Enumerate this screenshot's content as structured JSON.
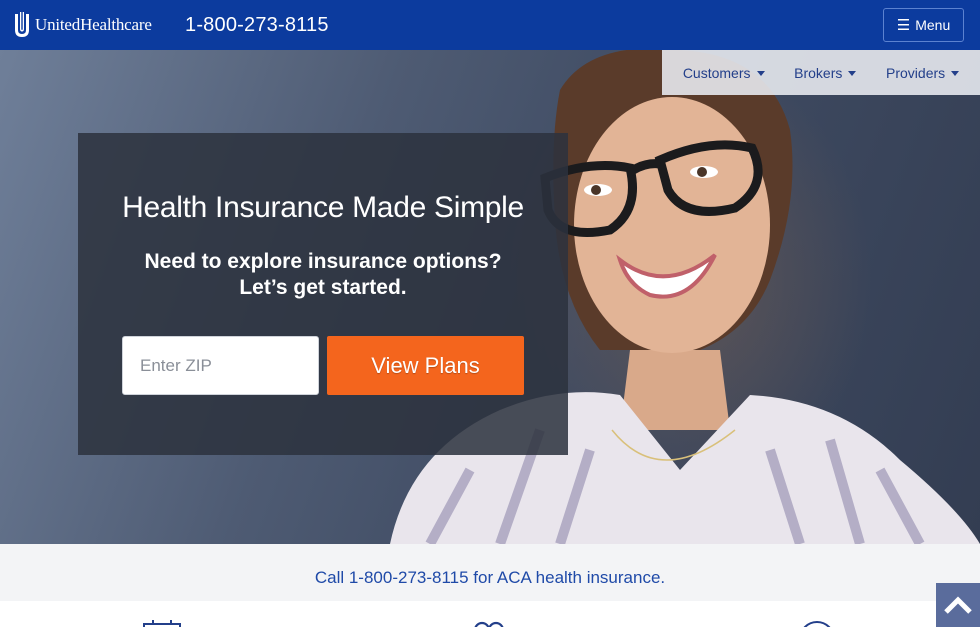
{
  "header": {
    "logo_text": "UnitedHealthcare",
    "phone": "1-800-273-8115",
    "menu_label": "Menu",
    "menu_icon": "hamburger-icon"
  },
  "subnav": {
    "items": [
      {
        "label": "Customers"
      },
      {
        "label": "Brokers"
      },
      {
        "label": "Providers"
      }
    ]
  },
  "hero": {
    "title": "Health Insurance Made Simple",
    "subtitle_line1": "Need to explore insurance options?",
    "subtitle_line2": "Let’s get started.",
    "zip": {
      "placeholder": "Enter ZIP",
      "value": ""
    },
    "cta_label": "View Plans"
  },
  "callbar": {
    "text": "Call 1-800-273-8115 for ACA health insurance."
  },
  "lower": {
    "icons": [
      "calendar-icon",
      "people-icon",
      "circle-icon"
    ]
  },
  "back_to_top": {
    "icon": "chevron-up-icon"
  },
  "colors": {
    "brand_blue": "#0c3b9e",
    "cta_orange": "#f4651d",
    "link_blue": "#1f4aa8"
  }
}
